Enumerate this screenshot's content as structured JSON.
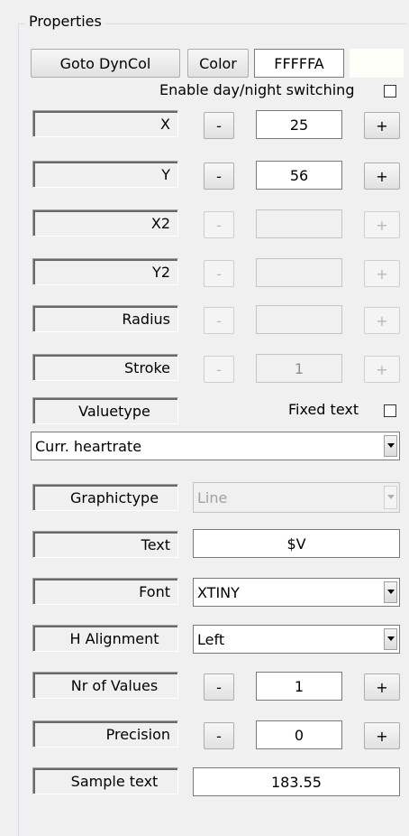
{
  "group_title": "Properties",
  "top": {
    "goto_label": "Goto DynCol",
    "color_label": "Color",
    "color_value": "FFFFFA",
    "swatch_color": "#fffffa"
  },
  "daynight_label": "Enable day/night switching",
  "daynight_checked": false,
  "rows": {
    "x": {
      "label": "X",
      "value": "25",
      "minus": "-",
      "plus": "+"
    },
    "y": {
      "label": "Y",
      "value": "56",
      "minus": "-",
      "plus": "+"
    },
    "x2": {
      "label": "X2",
      "value": "",
      "minus": "-",
      "plus": "+"
    },
    "y2": {
      "label": "Y2",
      "value": "",
      "minus": "-",
      "plus": "+"
    },
    "radius": {
      "label": "Radius",
      "value": "",
      "minus": "-",
      "plus": "+"
    },
    "stroke": {
      "label": "Stroke",
      "value": "1",
      "minus": "-",
      "plus": "+"
    }
  },
  "valuetype_label": "Valuetype",
  "fixed_text_label": "Fixed text",
  "valuetype_select": "Curr. heartrate",
  "graphictype_label": "Graphictype",
  "graphictype_select": "Line",
  "text_label": "Text",
  "text_value": "$V",
  "font_label": "Font",
  "font_select": "XTINY",
  "halign_label": "H Alignment",
  "halign_select": "Left",
  "nrvalues": {
    "label": "Nr of Values",
    "value": "1",
    "minus": "-",
    "plus": "+"
  },
  "precision": {
    "label": "Precision",
    "value": "0",
    "minus": "-",
    "plus": "+"
  },
  "sample_label": "Sample text",
  "sample_value": "183.55"
}
